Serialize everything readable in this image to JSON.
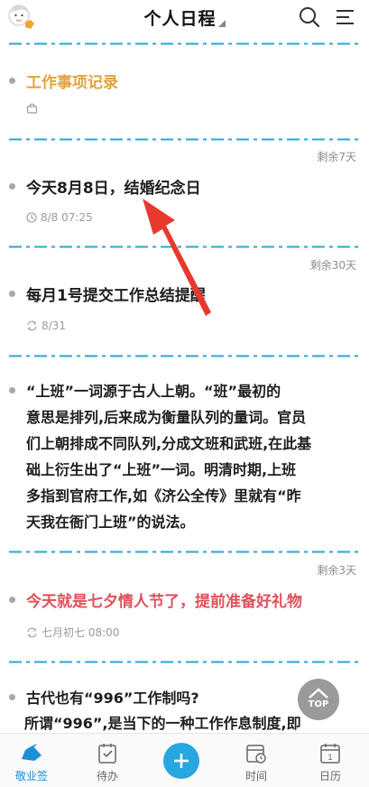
{
  "header": {
    "title": "个人日程"
  },
  "items": [
    {
      "title": "工作事项记录",
      "title_color": "#e0a33c"
    },
    {
      "remaining": "剩余7天",
      "title": "今天8月8日，结婚纪念日",
      "time": "8/8 07:25"
    },
    {
      "remaining": "剩余30天",
      "title": "每月1号提交工作总结提醒",
      "repeat": "8/31"
    },
    {
      "paragraph_lines": [
        "“上班”一词源于古人上朝。“班”最初的",
        "意思是排列,后来成为衡量队列的量词。官员",
        "们上朝排成不同队列,分成文班和武班,在此基",
        "础上衍生出了“上班”一词。明清时期,上班",
        "多指到官府工作,如《济公全传》里就有“昨",
        "天我在衙门上班”的说法。"
      ]
    },
    {
      "remaining": "剩余3天",
      "title": "今天就是七夕情人节了，提前准备好礼物",
      "title_color": "#e0505a",
      "repeat": "七月初七 08:00"
    },
    {
      "lines": [
        "古代也有“996”工作制吗?",
        "所谓“996”,是当下的一种工作作息制度,即"
      ]
    }
  ],
  "top_button": {
    "label": "TOP"
  },
  "bottom_nav": [
    {
      "label": "敬业签",
      "active": true
    },
    {
      "label": "待办"
    },
    {
      "label": ""
    },
    {
      "label": "时间"
    },
    {
      "label": "日历"
    }
  ],
  "colors": {
    "divider": "#2aa6d6",
    "accent": "#1e8fd6",
    "add_button": "#27a6e0",
    "arrow": "#e8392f"
  }
}
